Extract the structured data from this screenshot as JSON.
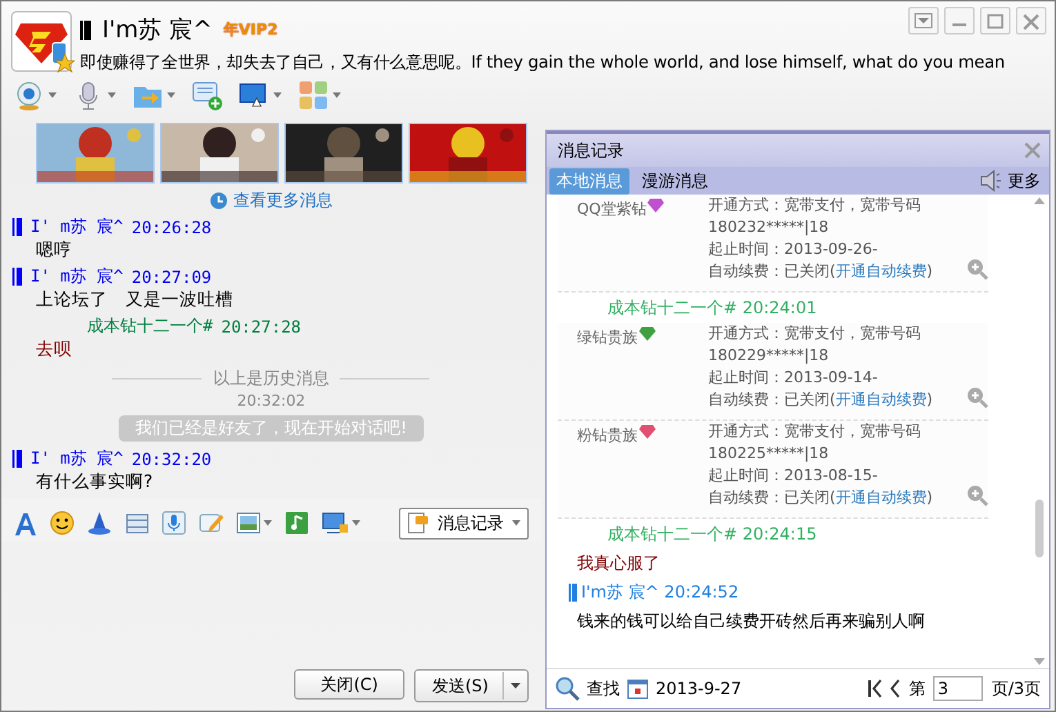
{
  "header": {
    "name": "I'm苏 宸^",
    "vip_badge": "年VIP2",
    "status": "即使赚得了全世界，却失去了自己，又有什么意思呢。If they gain the whole world, and lose himself, what do you mean"
  },
  "chat": {
    "more_link": "查看更多消息",
    "messages": [
      {
        "kind": "own",
        "sender": "I' m苏 宸^",
        "time": "20:26:28",
        "text": "嗯哼"
      },
      {
        "kind": "own",
        "sender": "I' m苏 宸^",
        "time": "20:27:09",
        "text": "上论坛了　又是一波吐槽"
      },
      {
        "kind": "friend",
        "sender": "成本钻十二一个#",
        "time": "20:27:28",
        "text": "去呗"
      },
      {
        "kind": "divider",
        "text": "以上是历史消息"
      },
      {
        "kind": "timestamp",
        "text": "20:32:02"
      },
      {
        "kind": "notice",
        "text": "我们已经是好友了，现在开始对话吧!"
      },
      {
        "kind": "own",
        "sender": "I' m苏 宸^",
        "time": "20:32:20",
        "text": "有什么事实啊?"
      }
    ]
  },
  "input_toolbar": {
    "history_button": "消息记录"
  },
  "buttons": {
    "close": "关闭(C)",
    "send": "发送(S)"
  },
  "history": {
    "title": "消息记录",
    "tabs": [
      {
        "label": "本地消息",
        "selected": true
      },
      {
        "label": "漫游消息",
        "selected": false
      }
    ],
    "more": "更多",
    "entries": [
      {
        "kind": "card",
        "name": "QQ堂紫钻",
        "color": "#c050d0",
        "lines": [
          "开通方式：宽带支付，宽带号码",
          "180232*****|18",
          "起止时间：2013-09-26-"
        ],
        "renew": "自动续费：已关闭(",
        "renew_link": "开通自动续费",
        "renew_end": ")"
      },
      {
        "kind": "friend_sender",
        "text": "成本钻十二一个# 20:24:01"
      },
      {
        "kind": "card",
        "name": "绿钻贵族",
        "color": "#40a040",
        "lines": [
          "开通方式：宽带支付，宽带号码",
          "180229*****|18",
          "起止时间：2013-09-14-"
        ],
        "renew": "自动续费：已关闭(",
        "renew_link": "开通自动续费",
        "renew_end": ")"
      },
      {
        "kind": "card",
        "name": "粉钻贵族",
        "color": "#e05070",
        "lines": [
          "开通方式：宽带支付，宽带号码",
          "180225*****|18",
          "起止时间：2013-08-15-"
        ],
        "renew": "自动续费：已关闭(",
        "renew_link": "开通自动续费",
        "renew_end": ")"
      },
      {
        "kind": "friend_sender",
        "text": "成本钻十二一个# 20:24:15"
      },
      {
        "kind": "friend_message",
        "text": "我真心服了"
      },
      {
        "kind": "own_sender",
        "text": "I'm苏 宸^ 20:24:52"
      },
      {
        "kind": "own_message",
        "text": "钱来的钱可以给自己续费开砖然后再来骗别人啊"
      }
    ],
    "footer": {
      "find": "查找",
      "date": "2013-9-27",
      "page_prefix": "第",
      "page": "3",
      "page_suffix": "页/3页"
    }
  }
}
